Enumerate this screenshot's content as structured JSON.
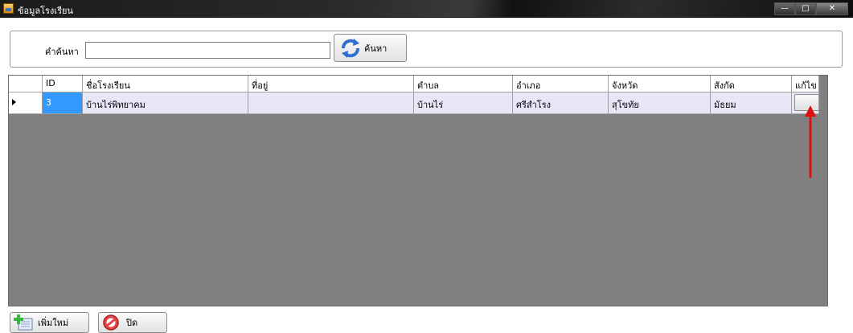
{
  "window": {
    "title": "ข้อมูลโรงเรียน",
    "controls": {
      "minimize": "—",
      "maximize": "□",
      "close": "✕"
    }
  },
  "search": {
    "label": "คำค้นหา",
    "value": "",
    "button_label": "ค้นหา",
    "button_icon": "refresh-icon"
  },
  "grid": {
    "columns": [
      "",
      "ID",
      "ชื่อโรงเรียน",
      "ที่อยู่",
      "ตำบล",
      "อำเภอ",
      "จังหวัด",
      "สังกัด",
      "แก้ไข"
    ],
    "rows": [
      {
        "id": "3",
        "school_name": "บ้านไร่พิทยาคม",
        "address": "",
        "subdistrict": "บ้านไร่",
        "district": "ศรีสำโรง",
        "province": "สุโขทัย",
        "affiliation": "มัธยม",
        "edit_label": ""
      }
    ]
  },
  "bottom": {
    "add_label": "เพิ่มใหม่",
    "add_icon": "add-icon",
    "close_label": "ปิด",
    "close_icon": "cancel-icon"
  },
  "colors": {
    "selection": "#3399ff",
    "row_bg": "#e7e7f8",
    "grid_bg": "#808080",
    "annotation": "#e01010"
  }
}
